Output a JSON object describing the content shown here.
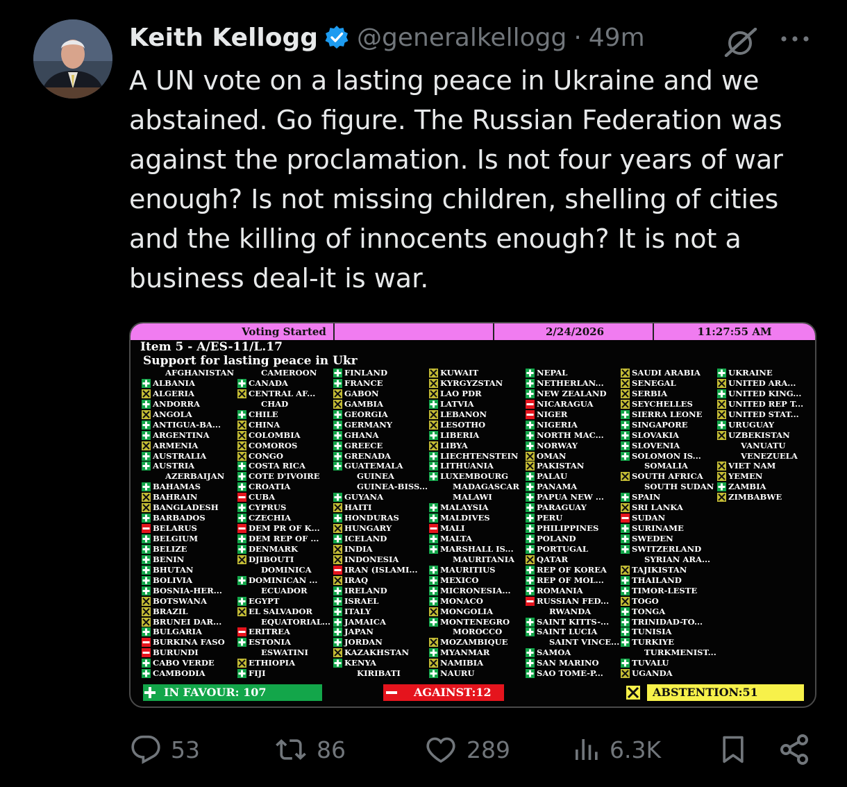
{
  "tweet": {
    "author_name": "Keith Kellogg",
    "handle": "@generalkellogg",
    "separator": "·",
    "time": "49m",
    "text_lines": [
      "A UN vote on a lasting peace in Ukraine and we",
      "abstained. Go figure. The Russian Federation was",
      "against the proclamation. Is not four years of war",
      "enough? Is not missing children, shelling of cities",
      "and the killing of innocents enough? It is not a",
      "business deal-it is war."
    ],
    "icons": {
      "verified": "verified-badge-icon",
      "grok": "grok-icon",
      "more": "more-icon"
    }
  },
  "board": {
    "status": "Voting Started",
    "date": "2/24/2026",
    "time": "11:27:55 AM",
    "item": "Item 5 - A/ES-11/L.17",
    "title": "Support for lasting peace in Ukr",
    "colors": {
      "favour": "#13a64a",
      "against": "#e5141d",
      "abstention": "#f7f14a",
      "header": "#f07cf0"
    },
    "columns": [
      [
        [
          "AFGHANISTAN",
          "n"
        ],
        [
          "ALBANIA",
          "y"
        ],
        [
          "ALGERIA",
          "a"
        ],
        [
          "ANDORRA",
          "y"
        ],
        [
          "ANGOLA",
          "a"
        ],
        [
          "ANTIGUA-BA...",
          "y"
        ],
        [
          "ARGENTINA",
          "y"
        ],
        [
          "ARMENIA",
          "a"
        ],
        [
          "AUSTRALIA",
          "y"
        ],
        [
          "AUSTRIA",
          "y"
        ],
        [
          "AZERBAIJAN",
          "n"
        ],
        [
          "BAHAMAS",
          "y"
        ],
        [
          "BAHRAIN",
          "a"
        ],
        [
          "BANGLADESH",
          "a"
        ],
        [
          "BARBADOS",
          "y"
        ],
        [
          "BELARUS",
          "r"
        ],
        [
          "BELGIUM",
          "y"
        ],
        [
          "BELIZE",
          "y"
        ],
        [
          "BENIN",
          "y"
        ],
        [
          "BHUTAN",
          "y"
        ],
        [
          "BOLIVIA",
          "y"
        ],
        [
          "BOSNIA-HER...",
          "y"
        ],
        [
          "BOTSWANA",
          "a"
        ],
        [
          "BRAZIL",
          "a"
        ],
        [
          "BRUNEI DAR...",
          "a"
        ],
        [
          "BULGARIA",
          "y"
        ],
        [
          "BURKINA FASO",
          "r"
        ],
        [
          "BURUNDI",
          "r"
        ],
        [
          "CABO VERDE",
          "y"
        ],
        [
          "CAMBODIA",
          "y"
        ]
      ],
      [
        [
          "CAMEROON",
          "n"
        ],
        [
          "CANADA",
          "y"
        ],
        [
          "CENTRAL AF...",
          "a"
        ],
        [
          "CHAD",
          "n"
        ],
        [
          "CHILE",
          "y"
        ],
        [
          "CHINA",
          "a"
        ],
        [
          "COLOMBIA",
          "a"
        ],
        [
          "COMOROS",
          "a"
        ],
        [
          "CONGO",
          "a"
        ],
        [
          "COSTA RICA",
          "y"
        ],
        [
          "COTE D'IVOIRE",
          "y"
        ],
        [
          "CROATIA",
          "y"
        ],
        [
          "CUBA",
          "r"
        ],
        [
          "CYPRUS",
          "y"
        ],
        [
          "CZECHIA",
          "y"
        ],
        [
          "DEM PR OF K...",
          "r"
        ],
        [
          "DEM REP OF ...",
          "y"
        ],
        [
          "DENMARK",
          "y"
        ],
        [
          "DJIBOUTI",
          "a"
        ],
        [
          "DOMINICA",
          "n"
        ],
        [
          "DOMINICAN ...",
          "y"
        ],
        [
          "ECUADOR",
          "n"
        ],
        [
          "EGYPT",
          "y"
        ],
        [
          "EL SALVADOR",
          "a"
        ],
        [
          "EQUATORIAL...",
          "n"
        ],
        [
          "ERITREA",
          "r"
        ],
        [
          "ESTONIA",
          "y"
        ],
        [
          "ESWATINI",
          "n"
        ],
        [
          "ETHIOPIA",
          "a"
        ],
        [
          "FIJI",
          "y"
        ]
      ],
      [
        [
          "FINLAND",
          "y"
        ],
        [
          "FRANCE",
          "y"
        ],
        [
          "GABON",
          "a"
        ],
        [
          "GAMBIA",
          "a"
        ],
        [
          "GEORGIA",
          "y"
        ],
        [
          "GERMANY",
          "y"
        ],
        [
          "GHANA",
          "y"
        ],
        [
          "GREECE",
          "y"
        ],
        [
          "GRENADA",
          "y"
        ],
        [
          "GUATEMALA",
          "y"
        ],
        [
          "GUINEA",
          "n"
        ],
        [
          "GUINEA-BISS...",
          "n"
        ],
        [
          "GUYANA",
          "y"
        ],
        [
          "HAITI",
          "a"
        ],
        [
          "HONDURAS",
          "y"
        ],
        [
          "HUNGARY",
          "a"
        ],
        [
          "ICELAND",
          "y"
        ],
        [
          "INDIA",
          "a"
        ],
        [
          "INDONESIA",
          "a"
        ],
        [
          "IRAN (ISLAMI...",
          "r"
        ],
        [
          "IRAQ",
          "a"
        ],
        [
          "IRELAND",
          "y"
        ],
        [
          "ISRAEL",
          "y"
        ],
        [
          "ITALY",
          "y"
        ],
        [
          "JAMAICA",
          "y"
        ],
        [
          "JAPAN",
          "y"
        ],
        [
          "JORDAN",
          "y"
        ],
        [
          "KAZAKHSTAN",
          "a"
        ],
        [
          "KENYA",
          "y"
        ],
        [
          "KIRIBATI",
          "n"
        ]
      ],
      [
        [
          "KUWAIT",
          "a"
        ],
        [
          "KYRGYZSTAN",
          "a"
        ],
        [
          "LAO PDR",
          "a"
        ],
        [
          "LATVIA",
          "y"
        ],
        [
          "LEBANON",
          "a"
        ],
        [
          "LESOTHO",
          "a"
        ],
        [
          "LIBERIA",
          "y"
        ],
        [
          "LIBYA",
          "a"
        ],
        [
          "LIECHTENSTEIN",
          "y"
        ],
        [
          "LITHUANIA",
          "y"
        ],
        [
          "LUXEMBOURG",
          "y"
        ],
        [
          "MADAGASCAR",
          "n"
        ],
        [
          "MALAWI",
          "n"
        ],
        [
          "MALAYSIA",
          "y"
        ],
        [
          "MALDIVES",
          "y"
        ],
        [
          "MALI",
          "r"
        ],
        [
          "MALTA",
          "y"
        ],
        [
          "MARSHALL IS...",
          "y"
        ],
        [
          "MAURITANIA",
          "n"
        ],
        [
          "MAURITIUS",
          "y"
        ],
        [
          "MEXICO",
          "y"
        ],
        [
          "MICRONESIA...",
          "y"
        ],
        [
          "MONACO",
          "y"
        ],
        [
          "MONGOLIA",
          "a"
        ],
        [
          "MONTENEGRO",
          "y"
        ],
        [
          "MOROCCO",
          "n"
        ],
        [
          "MOZAMBIQUE",
          "a"
        ],
        [
          "MYANMAR",
          "y"
        ],
        [
          "NAMIBIA",
          "a"
        ],
        [
          "NAURU",
          "y"
        ]
      ],
      [
        [
          "NEPAL",
          "y"
        ],
        [
          "NETHERLAN...",
          "y"
        ],
        [
          "NEW ZEALAND",
          "y"
        ],
        [
          "NICARAGUA",
          "r"
        ],
        [
          "NIGER",
          "r"
        ],
        [
          "NIGERIA",
          "y"
        ],
        [
          "NORTH MAC...",
          "y"
        ],
        [
          "NORWAY",
          "y"
        ],
        [
          "OMAN",
          "a"
        ],
        [
          "PAKISTAN",
          "a"
        ],
        [
          "PALAU",
          "y"
        ],
        [
          "PANAMA",
          "y"
        ],
        [
          "PAPUA NEW ...",
          "y"
        ],
        [
          "PARAGUAY",
          "y"
        ],
        [
          "PERU",
          "y"
        ],
        [
          "PHILIPPINES",
          "y"
        ],
        [
          "POLAND",
          "y"
        ],
        [
          "PORTUGAL",
          "y"
        ],
        [
          "QATAR",
          "a"
        ],
        [
          "REP OF KOREA",
          "y"
        ],
        [
          "REP OF MOL...",
          "y"
        ],
        [
          "ROMANIA",
          "y"
        ],
        [
          "RUSSIAN FED...",
          "r"
        ],
        [
          "RWANDA",
          "n"
        ],
        [
          "SAINT KITTS-...",
          "y"
        ],
        [
          "SAINT LUCIA",
          "y"
        ],
        [
          "SAINT VINCE...",
          "n"
        ],
        [
          "SAMOA",
          "y"
        ],
        [
          "SAN MARINO",
          "y"
        ],
        [
          "SAO TOME-P...",
          "y"
        ]
      ],
      [
        [
          "SAUDI ARABIA",
          "a"
        ],
        [
          "SENEGAL",
          "a"
        ],
        [
          "SERBIA",
          "a"
        ],
        [
          "SEYCHELLES",
          "a"
        ],
        [
          "SIERRA LEONE",
          "y"
        ],
        [
          "SINGAPORE",
          "y"
        ],
        [
          "SLOVAKIA",
          "y"
        ],
        [
          "SLOVENIA",
          "y"
        ],
        [
          "SOLOMON IS...",
          "y"
        ],
        [
          "SOMALIA",
          "n"
        ],
        [
          "SOUTH AFRICA",
          "a"
        ],
        [
          "SOUTH SUDAN",
          "n"
        ],
        [
          "SPAIN",
          "y"
        ],
        [
          "SRI LANKA",
          "a"
        ],
        [
          "SUDAN",
          "r"
        ],
        [
          "SURINAME",
          "y"
        ],
        [
          "SWEDEN",
          "y"
        ],
        [
          "SWITZERLAND",
          "y"
        ],
        [
          "SYRIAN ARA...",
          "n"
        ],
        [
          "TAJIKISTAN",
          "a"
        ],
        [
          "THAILAND",
          "y"
        ],
        [
          "TIMOR-LESTE",
          "y"
        ],
        [
          "TOGO",
          "a"
        ],
        [
          "TONGA",
          "y"
        ],
        [
          "TRINIDAD-TO...",
          "y"
        ],
        [
          "TUNISIA",
          "y"
        ],
        [
          "TURKIYE",
          "y"
        ],
        [
          "TURKMENIST...",
          "n"
        ],
        [
          "TUVALU",
          "y"
        ],
        [
          "UGANDA",
          "a"
        ]
      ],
      [
        [
          "UKRAINE",
          "y"
        ],
        [
          "UNITED ARA...",
          "a"
        ],
        [
          "UNITED KING...",
          "y"
        ],
        [
          "UNITED REP T...",
          "a"
        ],
        [
          "UNITED STAT...",
          "a"
        ],
        [
          "URUGUAY",
          "y"
        ],
        [
          "UZBEKISTAN",
          "a"
        ],
        [
          "VANUATU",
          "n"
        ],
        [
          "VENEZUELA",
          "n"
        ],
        [
          "VIET NAM",
          "a"
        ],
        [
          "YEMEN",
          "a"
        ],
        [
          "ZAMBIA",
          "y"
        ],
        [
          "ZIMBABWE",
          "a"
        ]
      ]
    ],
    "totals": {
      "favour_label": "IN FAVOUR: 107",
      "against_label": "AGAINST:12",
      "abstention_label": "ABSTENTION:51"
    }
  },
  "actions": {
    "replies": "53",
    "reposts": "86",
    "likes": "289",
    "views": "6.3K",
    "icons": [
      "reply-icon",
      "repost-icon",
      "like-icon",
      "views-icon",
      "bookmark-icon",
      "share-icon"
    ]
  }
}
